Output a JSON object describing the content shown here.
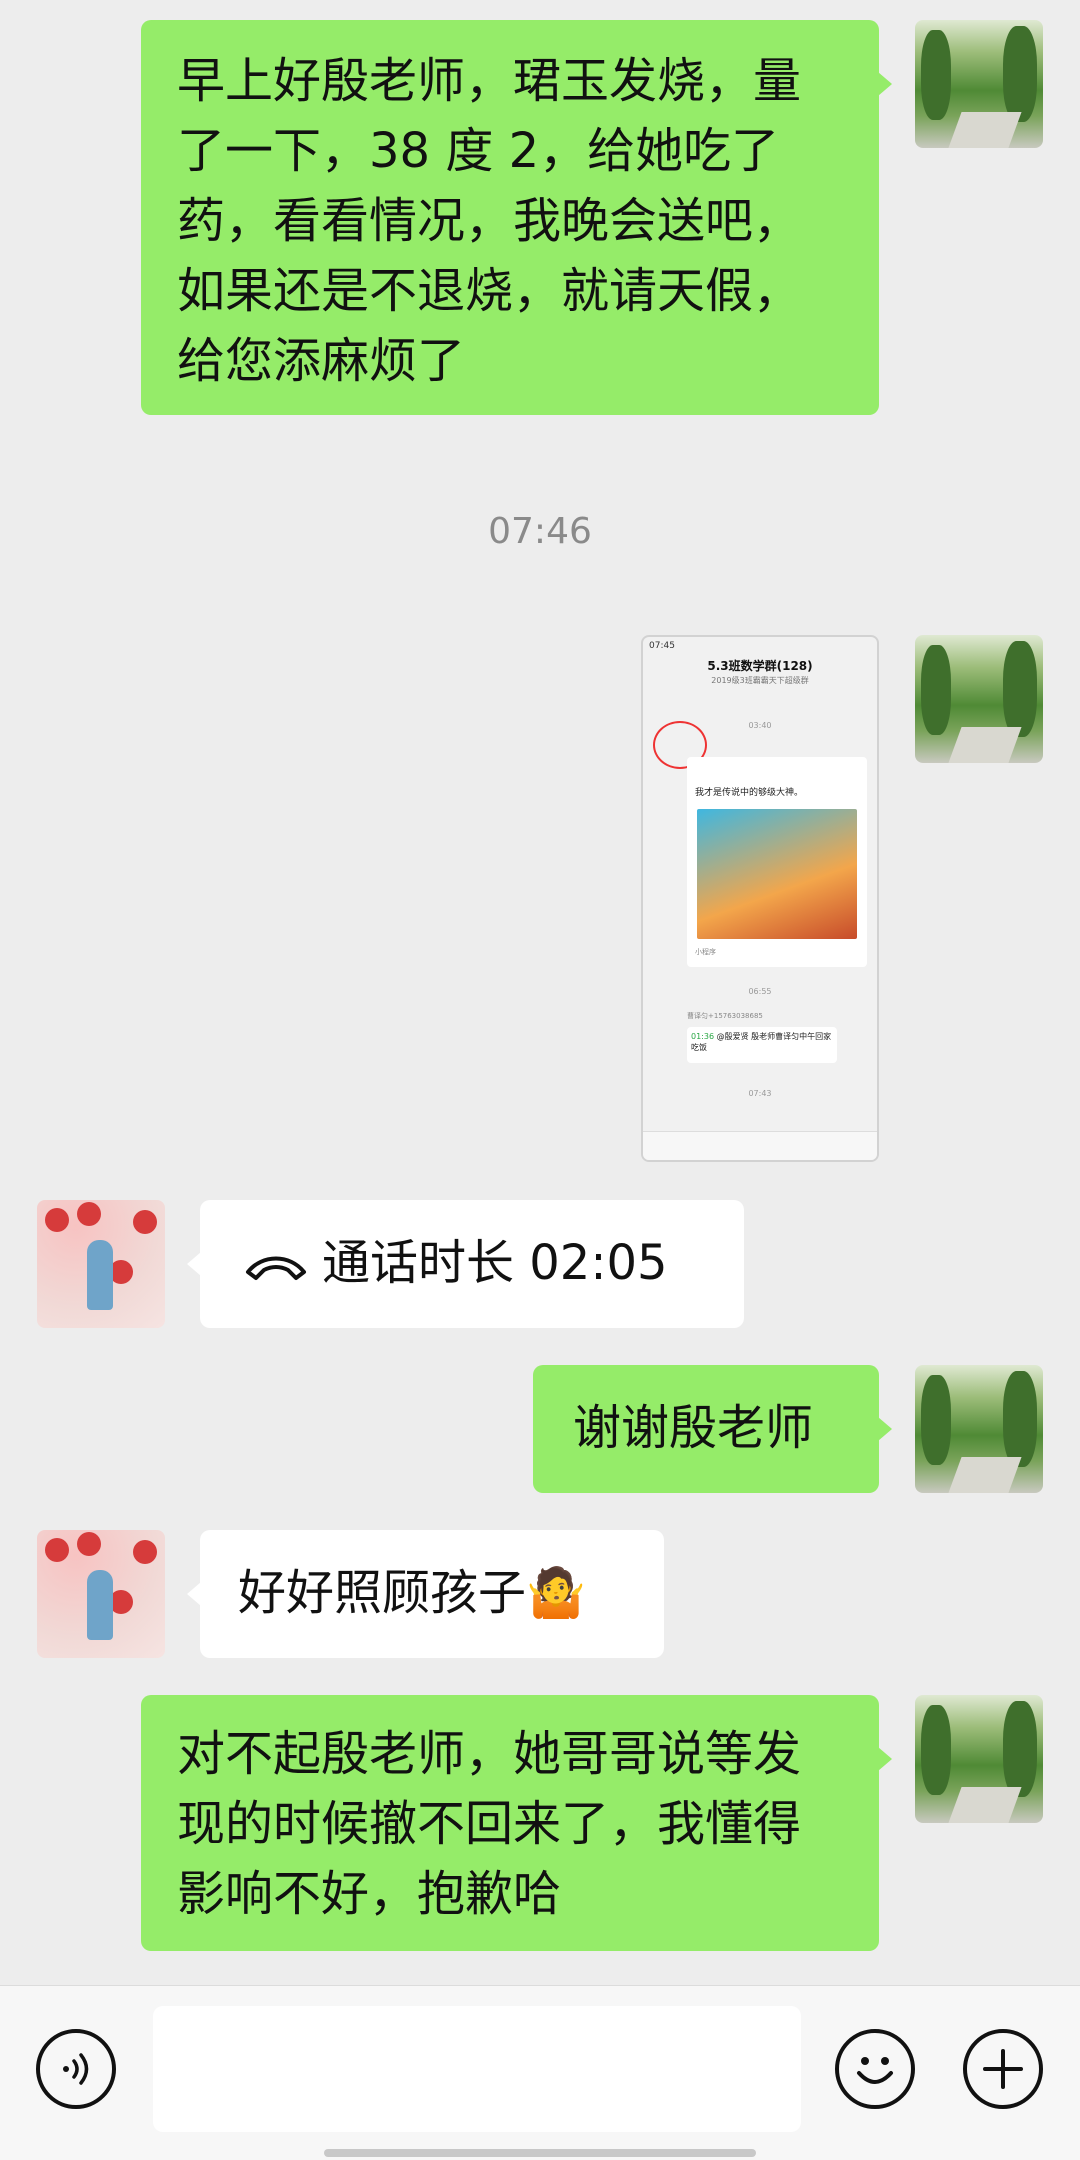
{
  "messages": [
    {
      "from": "self",
      "text": "早上好殷老师，珺玉发烧，量了一下，38 度 2，给她吃了药，看看情况，我晚会送吧，如果还是不退烧，就请天假，给您添麻烦了"
    },
    {
      "type": "time",
      "text": "07:46"
    },
    {
      "from": "self",
      "type": "image"
    },
    {
      "from": "teacher",
      "type": "call",
      "icon": "phone-hangup-icon",
      "text": "通话时长 02:05"
    },
    {
      "from": "self",
      "text": "谢谢殷老师"
    },
    {
      "from": "teacher",
      "text": "好好照顾孩子",
      "emoji": "🤷"
    },
    {
      "from": "self",
      "text": "对不起殷老师，她哥哥说等发现的时候撤不回来了，我懂得影响不好，抱歉哈"
    }
  ],
  "screenshot": {
    "status": "07:45",
    "group_title": "5.3班数学群(128)",
    "group_subtitle": "2019级3班霸霸天下超级群",
    "time1": "03:40",
    "card_text": "我才是传说中的够级大神。",
    "mini_program": "小程序",
    "time2": "06:55",
    "call_sender": "曹译匀+15763038685",
    "call_duration": "01:36",
    "call_text": "@殷爱贤 殷老师曹译匀中午回家吃饭",
    "time3": "07:43"
  },
  "toolbar": {
    "voice_icon": "voice-icon",
    "emoji_icon": "emoji-icon",
    "plus_icon": "plus-icon"
  }
}
